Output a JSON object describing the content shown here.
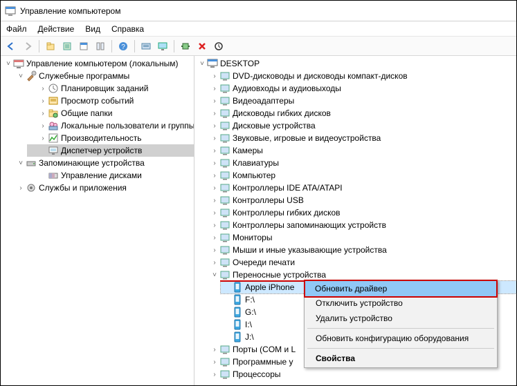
{
  "window": {
    "title": "Управление компьютером"
  },
  "menu": {
    "file": "Файл",
    "action": "Действие",
    "view": "Вид",
    "help": "Справка"
  },
  "toolbar_icons": [
    "back",
    "forward",
    "up",
    "folders",
    "props",
    "refresh",
    "exportlist",
    "help",
    "show",
    "monitor",
    "cfg",
    "device",
    "delete",
    "scan"
  ],
  "left_tree": {
    "root": "Управление компьютером (локальным)",
    "groups": [
      {
        "label": "Служебные программы",
        "expanded": true,
        "children": [
          {
            "label": "Планировщик заданий"
          },
          {
            "label": "Просмотр событий"
          },
          {
            "label": "Общие папки"
          },
          {
            "label": "Локальные пользователи и группы"
          },
          {
            "label": "Производительность"
          },
          {
            "label": "Диспетчер устройств",
            "selected": true
          }
        ]
      },
      {
        "label": "Запоминающие устройства",
        "expanded": true,
        "children": [
          {
            "label": "Управление дисками"
          }
        ]
      },
      {
        "label": "Службы и приложения",
        "expanded": false
      }
    ]
  },
  "right_tree": {
    "root": "DESKTOP",
    "items": [
      {
        "label": "DVD-дисководы и дисководы компакт-дисков"
      },
      {
        "label": "Аудиовходы и аудиовыходы"
      },
      {
        "label": "Видеоадаптеры"
      },
      {
        "label": "Дисководы гибких дисков"
      },
      {
        "label": "Дисковые устройства"
      },
      {
        "label": "Звуковые, игровые и видеоустройства"
      },
      {
        "label": "Камеры"
      },
      {
        "label": "Клавиатуры"
      },
      {
        "label": "Компьютер"
      },
      {
        "label": "Контроллеры IDE ATA/ATAPI"
      },
      {
        "label": "Контроллеры USB"
      },
      {
        "label": "Контроллеры гибких дисков"
      },
      {
        "label": "Контроллеры запоминающих устройств"
      },
      {
        "label": "Мониторы"
      },
      {
        "label": "Мыши и иные указывающие устройства"
      },
      {
        "label": "Очереди печати"
      },
      {
        "label": "Переносные устройства",
        "expanded": true,
        "highlighted": true,
        "children": [
          {
            "label": "Apple iPhone",
            "selected": true
          },
          {
            "label": "F:\\"
          },
          {
            "label": "G:\\"
          },
          {
            "label": "I:\\"
          },
          {
            "label": "J:\\"
          }
        ]
      },
      {
        "label": "Порты (COM и L"
      },
      {
        "label": "Программные у"
      },
      {
        "label": "Процессоры"
      }
    ]
  },
  "context_menu": {
    "items": [
      {
        "label": "Обновить драйвер",
        "hover": true,
        "boxed": true
      },
      {
        "label": "Отключить устройство"
      },
      {
        "label": "Удалить устройство"
      },
      {
        "sep": true
      },
      {
        "label": "Обновить конфигурацию оборудования"
      },
      {
        "sep": true
      },
      {
        "label": "Свойства",
        "bold": true
      }
    ]
  }
}
